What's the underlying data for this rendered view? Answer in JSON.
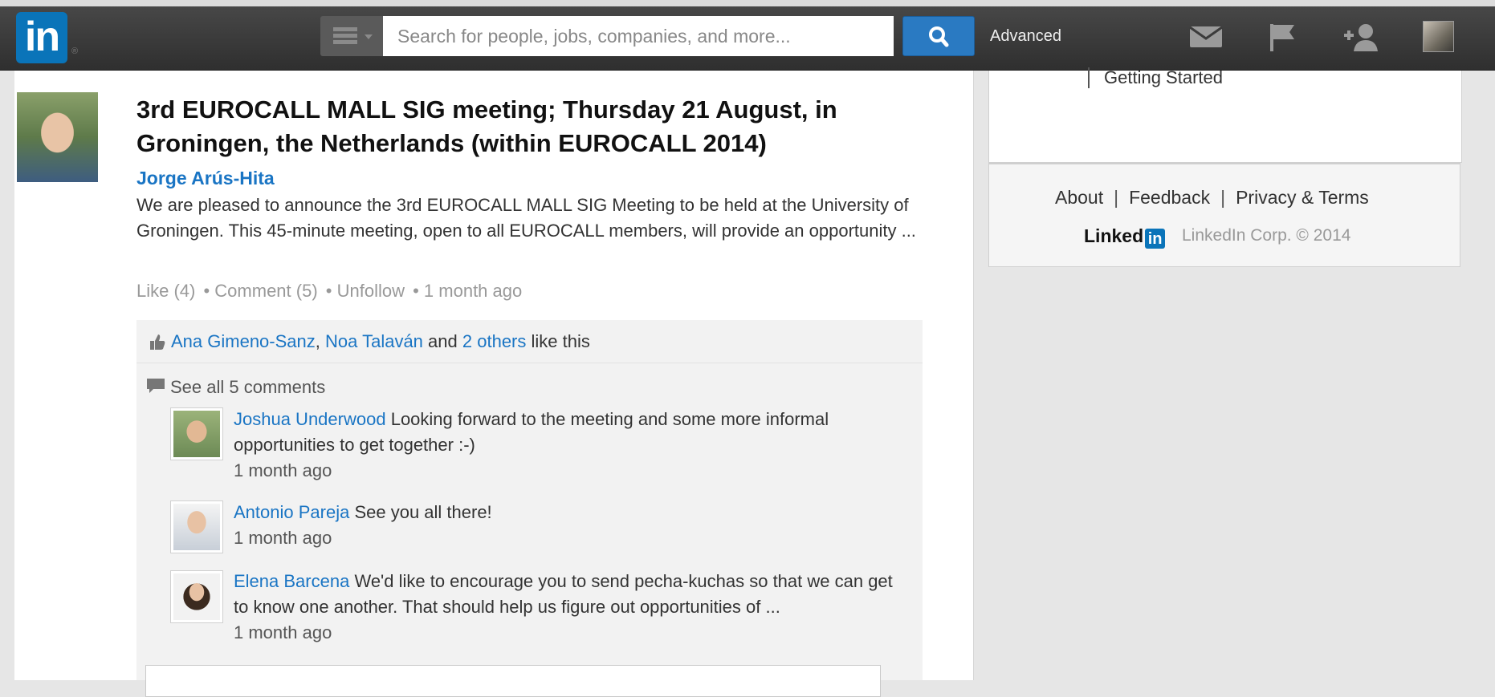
{
  "nav": {
    "logo": "in",
    "logo_reg": "®",
    "search_placeholder": "Search for people, jobs, companies, and more...",
    "advanced": "Advanced"
  },
  "post": {
    "title": "3rd EUROCALL MALL SIG meeting; Thursday 21 August, in Groningen, the Netherlands (within EUROCALL 2014)",
    "author": "Jorge Arús-Hita",
    "body": "We are pleased to announce the 3rd EUROCALL MALL SIG Meeting to be held at the University of Groningen. This 45-minute meeting, open to all EUROCALL members, will provide an opportunity ...",
    "like": "Like (4)",
    "comment": "• Comment (5)",
    "unfollow": "• Unfollow",
    "time": "• 1 month ago"
  },
  "likes": {
    "person1": "Ana Gimeno-Sanz",
    "comma": ",",
    "person2": "Noa Talaván",
    "and": "and",
    "others": "2 others",
    "suffix": "like this"
  },
  "see_all": "See all 5 comments",
  "comments": [
    {
      "name": "Joshua Underwood",
      "text": "Looking forward to the meeting and some more informal opportunities to get together :-)",
      "time": "1 month ago"
    },
    {
      "name": "Antonio Pareja",
      "text": "See you all there!",
      "time": "1 month ago"
    },
    {
      "name": "Elena Barcena",
      "text": "We'd like to encourage you to send pecha-kuchas so that we can get to know one another. That should help us figure out opportunities of ...",
      "time": "1 month ago"
    }
  ],
  "sidebar": {
    "getting_started": "Getting Started"
  },
  "footer": {
    "about": "About",
    "feedback": "Feedback",
    "privacy": "Privacy & Terms",
    "sep": "|",
    "brand": "Linked",
    "brand_in": "in",
    "corp": "LinkedIn Corp. © 2014"
  },
  "colors": {
    "accent": "#0a74b9",
    "link": "#1a75c4",
    "navbar": "#3a3a3a"
  }
}
